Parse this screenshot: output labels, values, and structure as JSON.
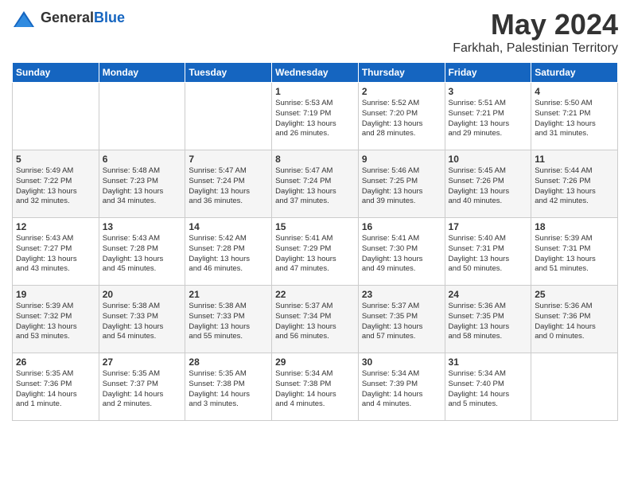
{
  "logo": {
    "text_general": "General",
    "text_blue": "Blue"
  },
  "title": {
    "month_year": "May 2024",
    "location": "Farkhah, Palestinian Territory"
  },
  "days_of_week": [
    "Sunday",
    "Monday",
    "Tuesday",
    "Wednesday",
    "Thursday",
    "Friday",
    "Saturday"
  ],
  "weeks": [
    [
      {
        "day": "",
        "info": ""
      },
      {
        "day": "",
        "info": ""
      },
      {
        "day": "",
        "info": ""
      },
      {
        "day": "1",
        "info": "Sunrise: 5:53 AM\nSunset: 7:19 PM\nDaylight: 13 hours\nand 26 minutes."
      },
      {
        "day": "2",
        "info": "Sunrise: 5:52 AM\nSunset: 7:20 PM\nDaylight: 13 hours\nand 28 minutes."
      },
      {
        "day": "3",
        "info": "Sunrise: 5:51 AM\nSunset: 7:21 PM\nDaylight: 13 hours\nand 29 minutes."
      },
      {
        "day": "4",
        "info": "Sunrise: 5:50 AM\nSunset: 7:21 PM\nDaylight: 13 hours\nand 31 minutes."
      }
    ],
    [
      {
        "day": "5",
        "info": "Sunrise: 5:49 AM\nSunset: 7:22 PM\nDaylight: 13 hours\nand 32 minutes."
      },
      {
        "day": "6",
        "info": "Sunrise: 5:48 AM\nSunset: 7:23 PM\nDaylight: 13 hours\nand 34 minutes."
      },
      {
        "day": "7",
        "info": "Sunrise: 5:47 AM\nSunset: 7:24 PM\nDaylight: 13 hours\nand 36 minutes."
      },
      {
        "day": "8",
        "info": "Sunrise: 5:47 AM\nSunset: 7:24 PM\nDaylight: 13 hours\nand 37 minutes."
      },
      {
        "day": "9",
        "info": "Sunrise: 5:46 AM\nSunset: 7:25 PM\nDaylight: 13 hours\nand 39 minutes."
      },
      {
        "day": "10",
        "info": "Sunrise: 5:45 AM\nSunset: 7:26 PM\nDaylight: 13 hours\nand 40 minutes."
      },
      {
        "day": "11",
        "info": "Sunrise: 5:44 AM\nSunset: 7:26 PM\nDaylight: 13 hours\nand 42 minutes."
      }
    ],
    [
      {
        "day": "12",
        "info": "Sunrise: 5:43 AM\nSunset: 7:27 PM\nDaylight: 13 hours\nand 43 minutes."
      },
      {
        "day": "13",
        "info": "Sunrise: 5:43 AM\nSunset: 7:28 PM\nDaylight: 13 hours\nand 45 minutes."
      },
      {
        "day": "14",
        "info": "Sunrise: 5:42 AM\nSunset: 7:28 PM\nDaylight: 13 hours\nand 46 minutes."
      },
      {
        "day": "15",
        "info": "Sunrise: 5:41 AM\nSunset: 7:29 PM\nDaylight: 13 hours\nand 47 minutes."
      },
      {
        "day": "16",
        "info": "Sunrise: 5:41 AM\nSunset: 7:30 PM\nDaylight: 13 hours\nand 49 minutes."
      },
      {
        "day": "17",
        "info": "Sunrise: 5:40 AM\nSunset: 7:31 PM\nDaylight: 13 hours\nand 50 minutes."
      },
      {
        "day": "18",
        "info": "Sunrise: 5:39 AM\nSunset: 7:31 PM\nDaylight: 13 hours\nand 51 minutes."
      }
    ],
    [
      {
        "day": "19",
        "info": "Sunrise: 5:39 AM\nSunset: 7:32 PM\nDaylight: 13 hours\nand 53 minutes."
      },
      {
        "day": "20",
        "info": "Sunrise: 5:38 AM\nSunset: 7:33 PM\nDaylight: 13 hours\nand 54 minutes."
      },
      {
        "day": "21",
        "info": "Sunrise: 5:38 AM\nSunset: 7:33 PM\nDaylight: 13 hours\nand 55 minutes."
      },
      {
        "day": "22",
        "info": "Sunrise: 5:37 AM\nSunset: 7:34 PM\nDaylight: 13 hours\nand 56 minutes."
      },
      {
        "day": "23",
        "info": "Sunrise: 5:37 AM\nSunset: 7:35 PM\nDaylight: 13 hours\nand 57 minutes."
      },
      {
        "day": "24",
        "info": "Sunrise: 5:36 AM\nSunset: 7:35 PM\nDaylight: 13 hours\nand 58 minutes."
      },
      {
        "day": "25",
        "info": "Sunrise: 5:36 AM\nSunset: 7:36 PM\nDaylight: 14 hours\nand 0 minutes."
      }
    ],
    [
      {
        "day": "26",
        "info": "Sunrise: 5:35 AM\nSunset: 7:36 PM\nDaylight: 14 hours\nand 1 minute."
      },
      {
        "day": "27",
        "info": "Sunrise: 5:35 AM\nSunset: 7:37 PM\nDaylight: 14 hours\nand 2 minutes."
      },
      {
        "day": "28",
        "info": "Sunrise: 5:35 AM\nSunset: 7:38 PM\nDaylight: 14 hours\nand 3 minutes."
      },
      {
        "day": "29",
        "info": "Sunrise: 5:34 AM\nSunset: 7:38 PM\nDaylight: 14 hours\nand 4 minutes."
      },
      {
        "day": "30",
        "info": "Sunrise: 5:34 AM\nSunset: 7:39 PM\nDaylight: 14 hours\nand 4 minutes."
      },
      {
        "day": "31",
        "info": "Sunrise: 5:34 AM\nSunset: 7:40 PM\nDaylight: 14 hours\nand 5 minutes."
      },
      {
        "day": "",
        "info": ""
      }
    ]
  ]
}
